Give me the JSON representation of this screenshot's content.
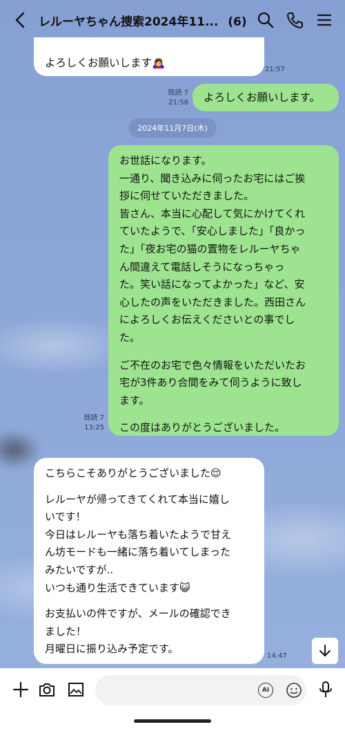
{
  "header": {
    "title": "レルーヤちゃん捜索2024年11...",
    "member_count": "(6)"
  },
  "messages": {
    "m1": {
      "text": "よろしくお願いします🙇‍♀️",
      "time": "21:57"
    },
    "m2": {
      "text": "よろしくお願いします。",
      "read": "既読 7",
      "time": "21:58"
    },
    "date": "2024年11月7日(木)",
    "m3": {
      "para1": "お世話になります。\n一通り、聞き込みに伺ったお宅にはご挨\n拶に伺せていただきました。\n皆さん、本当に心配して気にかけてくれ\nていたようで、「安心しました」「良かっ\nた」「夜お宅の猫の置物をレルーヤちゃ\nん間違えて電話しそうになっちゃっ\nた。笑い話になってよかった」など、安\n心したの声をいただきました。西田さん\nによろしくお伝えくださいとの事でし\nた。",
      "para2": "ご不在のお宅で色々情報をいただいたお\n宅が3件あり合間をみて伺うように致し\nます。",
      "para3": "この度はありがとうございました。",
      "read": "既読 7",
      "time": "13:25"
    },
    "m4": {
      "para1": "こちらこそありがとうございました😌",
      "para2": "レルーヤが帰ってきてくれて本当に嬉し\nいです！\n今日はレルーヤも落ち着いたようで甘え\nん坊モードも一緒に落ち着いてしまった\nみたいですが..\nいつも通り生活できています😺",
      "para3": "お支払いの件ですが、メールの確認でき\nました！\n月曜日に振り込み予定です。",
      "time": "14:47"
    }
  },
  "input": {
    "placeholder": "",
    "ai_label": "AI"
  },
  "colors": {
    "background": "#8ca6d6",
    "sent_bubble": "#9ee490",
    "received_bubble": "#ffffff"
  },
  "icons": [
    "back-icon",
    "search-icon",
    "phone-icon",
    "menu-icon",
    "plus-icon",
    "camera-icon",
    "image-icon",
    "ai-icon",
    "emoji-icon",
    "mic-icon",
    "arrow-down-icon"
  ]
}
